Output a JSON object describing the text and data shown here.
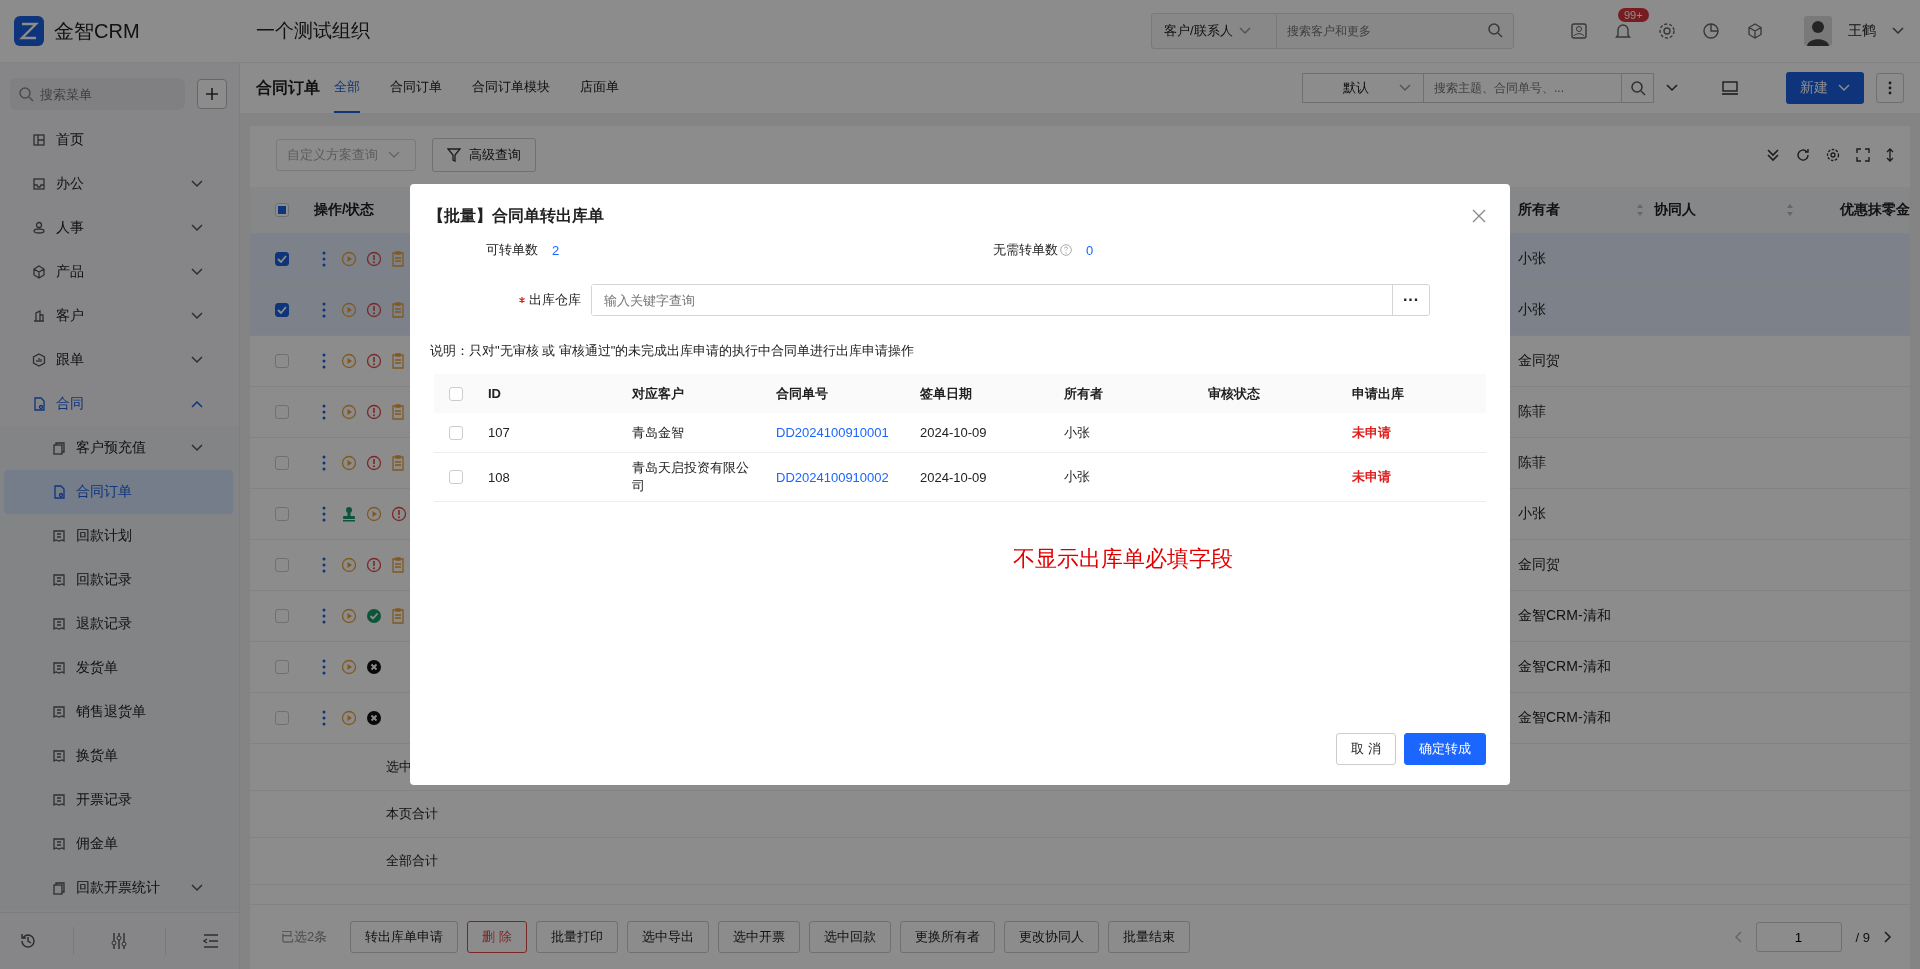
{
  "app": {
    "logo_text": "金智CRM",
    "organization": "一个测试组织",
    "search": {
      "scope": "客户/联系人",
      "placeholder": "搜索客户和更多"
    },
    "notifications_badge": "99+",
    "user_name": "王鹤"
  },
  "sidebar": {
    "search_placeholder": "搜索菜单",
    "items": [
      {
        "label": "首页",
        "selected": false
      },
      {
        "label": "办公",
        "selected": false,
        "expanded": false
      },
      {
        "label": "人事",
        "selected": false,
        "expanded": false
      },
      {
        "label": "产品",
        "selected": false,
        "expanded": false
      },
      {
        "label": "客户",
        "selected": false,
        "expanded": false
      },
      {
        "label": "跟单",
        "selected": false,
        "expanded": false
      },
      {
        "label": "合同",
        "selected": false,
        "expanded": true,
        "children": [
          {
            "label": "客户预充值",
            "selected": false,
            "expanded": false
          },
          {
            "label": "合同订单",
            "selected": true
          },
          {
            "label": "回款计划",
            "selected": false
          },
          {
            "label": "回款记录",
            "selected": false
          },
          {
            "label": "退款记录",
            "selected": false
          },
          {
            "label": "发货单",
            "selected": false
          },
          {
            "label": "销售退货单",
            "selected": false
          },
          {
            "label": "换货单",
            "selected": false
          },
          {
            "label": "开票记录",
            "selected": false
          },
          {
            "label": "佣金单",
            "selected": false
          },
          {
            "label": "回款开票统计",
            "selected": false,
            "expanded": false
          }
        ]
      }
    ]
  },
  "page": {
    "title": "合同订单",
    "tabs": [
      {
        "label": "全部",
        "selected": true
      },
      {
        "label": "合同订单",
        "selected": false
      },
      {
        "label": "合同订单模块",
        "selected": false
      },
      {
        "label": "店面单",
        "selected": false
      }
    ],
    "view": "默认",
    "search_placeholder": "搜索主题、合同单号、...",
    "new_button": "新建"
  },
  "filters": {
    "scheme_placeholder": "自定义方案查询",
    "advanced_button": "高级查询"
  },
  "table": {
    "header_checkbox": {
      "checked": false,
      "indeterminate": true
    },
    "columns": [
      "操作/状态",
      "所有者",
      "协同人",
      "优惠抹零金"
    ],
    "rows": [
      {
        "selected": true,
        "status": [
          {
            "kind": "play"
          },
          {
            "kind": "alert"
          },
          {
            "kind": "doc"
          }
        ],
        "owner": "小张"
      },
      {
        "selected": true,
        "status": [
          {
            "kind": "play"
          },
          {
            "kind": "alert"
          },
          {
            "kind": "doc"
          }
        ],
        "owner": "小张"
      },
      {
        "selected": false,
        "status": [
          {
            "kind": "play"
          },
          {
            "kind": "alert"
          },
          {
            "kind": "doc"
          }
        ],
        "owner": "金同贺"
      },
      {
        "selected": false,
        "status": [
          {
            "kind": "play"
          },
          {
            "kind": "alert"
          },
          {
            "kind": "doc"
          }
        ],
        "owner": "陈菲"
      },
      {
        "selected": false,
        "status": [
          {
            "kind": "play"
          },
          {
            "kind": "alert"
          },
          {
            "kind": "doc"
          }
        ],
        "owner": "陈菲"
      },
      {
        "selected": false,
        "status": [
          {
            "kind": "stamp"
          },
          {
            "kind": "play"
          },
          {
            "kind": "alert"
          }
        ],
        "owner": "小张"
      },
      {
        "selected": false,
        "status": [
          {
            "kind": "play"
          },
          {
            "kind": "alert"
          },
          {
            "kind": "doc"
          }
        ],
        "owner": "金同贺"
      },
      {
        "selected": false,
        "status": [
          {
            "kind": "play"
          },
          {
            "kind": "check"
          },
          {
            "kind": "doc"
          }
        ],
        "owner": "金智CRM-清和"
      },
      {
        "selected": false,
        "status": [
          {
            "kind": "play"
          },
          {
            "kind": "cross"
          }
        ],
        "owner": "金智CRM-清和"
      },
      {
        "selected": false,
        "status": [
          {
            "kind": "play"
          },
          {
            "kind": "cross"
          }
        ],
        "owner": "金智CRM-清和"
      }
    ],
    "summary_rows": [
      "选中",
      "本页合计",
      "全部合计"
    ]
  },
  "footer": {
    "selected_count": "已选2条",
    "buttons": [
      {
        "label": "转出库单申请",
        "kind": "default"
      },
      {
        "label": "删 除",
        "kind": "danger"
      },
      {
        "label": "批量打印",
        "kind": "default"
      },
      {
        "label": "选中导出",
        "kind": "default"
      },
      {
        "label": "选中开票",
        "kind": "default"
      },
      {
        "label": "选中回款",
        "kind": "default"
      },
      {
        "label": "更换所有者",
        "kind": "default"
      },
      {
        "label": "更改协同人",
        "kind": "default"
      },
      {
        "label": "批量结束",
        "kind": "default"
      }
    ],
    "page": "1",
    "total_pages": "/ 9"
  },
  "modal": {
    "title": "【批量】合同单转出库单",
    "stats": [
      {
        "label": "可转单数",
        "value": "2",
        "help": false
      },
      {
        "label": "无需转单数",
        "value": "0",
        "help": true
      }
    ],
    "warehouse_field": {
      "label": "出库仓库",
      "required": true,
      "placeholder": "输入关键字查询",
      "picker": "···"
    },
    "note": "说明：只对\"无审核 或 审核通过\"的未完成出库申请的执行中合同单进行出库申请操作",
    "table": {
      "header_checked": false,
      "columns": [
        "ID",
        "对应客户",
        "合同单号",
        "签单日期",
        "所有者",
        "审核状态",
        "申请出库"
      ],
      "rows": [
        {
          "checked": false,
          "id": "107",
          "customer": "青岛金智",
          "order_no": "DD2024100910001",
          "date": "2024-10-09",
          "owner": "小张",
          "apply": "未申请"
        },
        {
          "checked": false,
          "id": "108",
          "customer": "青岛天启投资有限公司",
          "order_no": "DD2024100910002",
          "date": "2024-10-09",
          "owner": "小张",
          "apply": "未申请"
        }
      ]
    },
    "annotation": "不显示出库单必填字段",
    "buttons": [
      {
        "label": "取 消",
        "kind": "default"
      },
      {
        "label": "确定转成",
        "kind": "primary"
      }
    ]
  }
}
